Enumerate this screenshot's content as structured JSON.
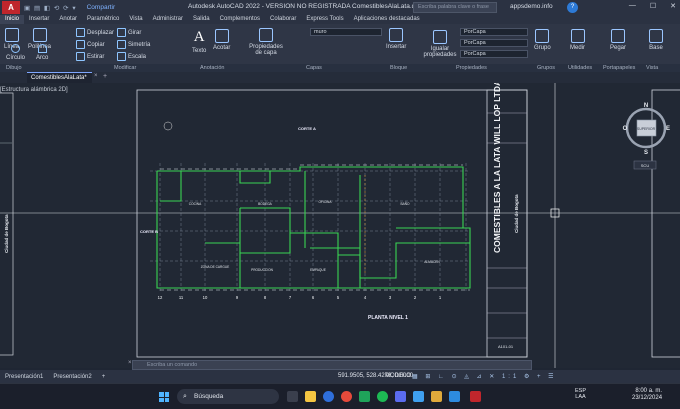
{
  "titlebar": {
    "app_letter": "A",
    "share": "Compartir",
    "title": "Autodesk AutoCAD 2022 - VERSION NO REGISTRADA   ComestiblesAlaLata.dwg",
    "search_placeholder": "Escriba palabra clave o frase",
    "user": "appsdemo.info",
    "help": "?",
    "minimize": "—",
    "maximize": "☐",
    "close": "✕"
  },
  "menu": [
    "Inicio",
    "Insertar",
    "Anotar",
    "Paramétrico",
    "Vista",
    "Administrar",
    "Salida",
    "Complementos",
    "Colaborar",
    "Express Tools",
    "Aplicaciones destacadas"
  ],
  "ribbon": {
    "draw_tools": [
      "Línea",
      "Polilínea",
      "Círculo",
      "Arco"
    ],
    "modify_tools": [
      "Desplazar",
      "Girar",
      "Copiar",
      "Simetría",
      "Estirar",
      "Escala"
    ],
    "text": "Texto",
    "dimension": "Acotar",
    "layer_props": "Propiedades de capa",
    "layer_name": "muro",
    "insert": "Insertar",
    "match_props": "Igualar propiedades",
    "bycapa_1": "PorCapa",
    "bycapa_2": "PorCapa",
    "bycapa_3": "PorCapa",
    "groups": "Grupo",
    "measure": "Medir",
    "paste": "Pegar",
    "base": "Base"
  },
  "panels": [
    "Dibujo",
    "Modificar",
    "Anotación",
    "Capas",
    "Bloque",
    "Propiedades",
    "Grupos",
    "Utilidades",
    "Portapapeles",
    "Vista"
  ],
  "doc_tab": {
    "name": "ComestiblesAlaLata*",
    "close": "×",
    "add": "+"
  },
  "viewport_label": "[Estructura alámbrica 2D]",
  "drawing": {
    "title_block_company": "COMESTIBLES A LA LATA WILL LOP LTDA",
    "title_block_city": "Ciudad de Bogota",
    "left_title": "Ciudad de Bogota",
    "plan_title": "PLANTA NIVEL 1",
    "section_a": "CORTE A",
    "section_b": "CORTE B",
    "sheet_number": "A101-01",
    "axis_labels": [
      "12",
      "11",
      "10",
      "9",
      "8",
      "7",
      "6",
      "5",
      "4",
      "3",
      "2",
      "1"
    ],
    "room_labels": [
      "COCINA",
      "BODEGA",
      "OFICINA",
      "BAÑO",
      "ZONA DE CARGUE",
      "PRODUCCION",
      "EMPAQUE",
      "ALMACEN"
    ]
  },
  "viewcube": {
    "north": "N",
    "south": "S",
    "east": "E",
    "west": "O",
    "center": "SUPERIOR",
    "wcs": "SCU"
  },
  "command": {
    "placeholder": "Escriba un comando",
    "close": "×"
  },
  "layout_tabs": [
    "Presentación1",
    "Presentación2",
    "+"
  ],
  "status": {
    "coords": "591.9505, 528.4278, 0.0000",
    "model": "MODELO",
    "scale": "1:1"
  },
  "taskbar": {
    "search": "Búsqueda",
    "lang": "ESP",
    "lang2": "LAA",
    "time": "8:00 a. m.",
    "date": "23/12/2024"
  },
  "colors": {
    "accent": "#2d7ad6",
    "logo": "#c0262c",
    "canvas": "#212834",
    "walls": "#39d353"
  }
}
